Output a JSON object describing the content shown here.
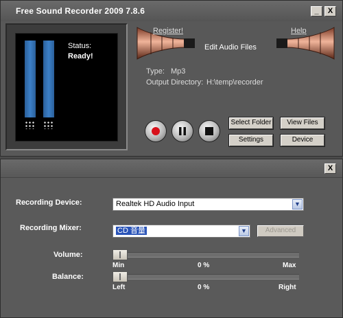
{
  "app": {
    "title": "Free Sound Recorder 2009 7.8.6",
    "minimize_label": "_",
    "close_label": "X"
  },
  "status": {
    "label": "Status:",
    "value": "Ready!"
  },
  "links": {
    "register": "Register!",
    "help": "Help"
  },
  "edit_audio_label": "Edit Audio Files",
  "info": {
    "type_label": "Type:",
    "type_value": "Mp3",
    "output_dir_label": "Output Directory:",
    "output_dir_value": "H:\\temp\\recorder"
  },
  "buttons": {
    "select_folder": "Select Folder",
    "view_files": "View Files",
    "settings": "Settings",
    "device": "Device"
  },
  "panel": {
    "close_label": "X",
    "recording_device_label": "Recording Device:",
    "recording_device_value": "Realtek HD Audio Input",
    "recording_mixer_label": "Recording Mixer:",
    "recording_mixer_value": "CD 音量",
    "advanced_label": "Advanced",
    "volume": {
      "label": "Volume:",
      "min_label": "Min",
      "value_label": "0 %",
      "max_label": "Max",
      "value": 0
    },
    "balance": {
      "label": "Balance:",
      "min_label": "Left",
      "value_label": "0 %",
      "max_label": "Right",
      "value": 0
    }
  },
  "colors": {
    "record_button": "#d8101a",
    "level_bar": "#3c80c8",
    "selection_highlight": "#2a54b8"
  }
}
